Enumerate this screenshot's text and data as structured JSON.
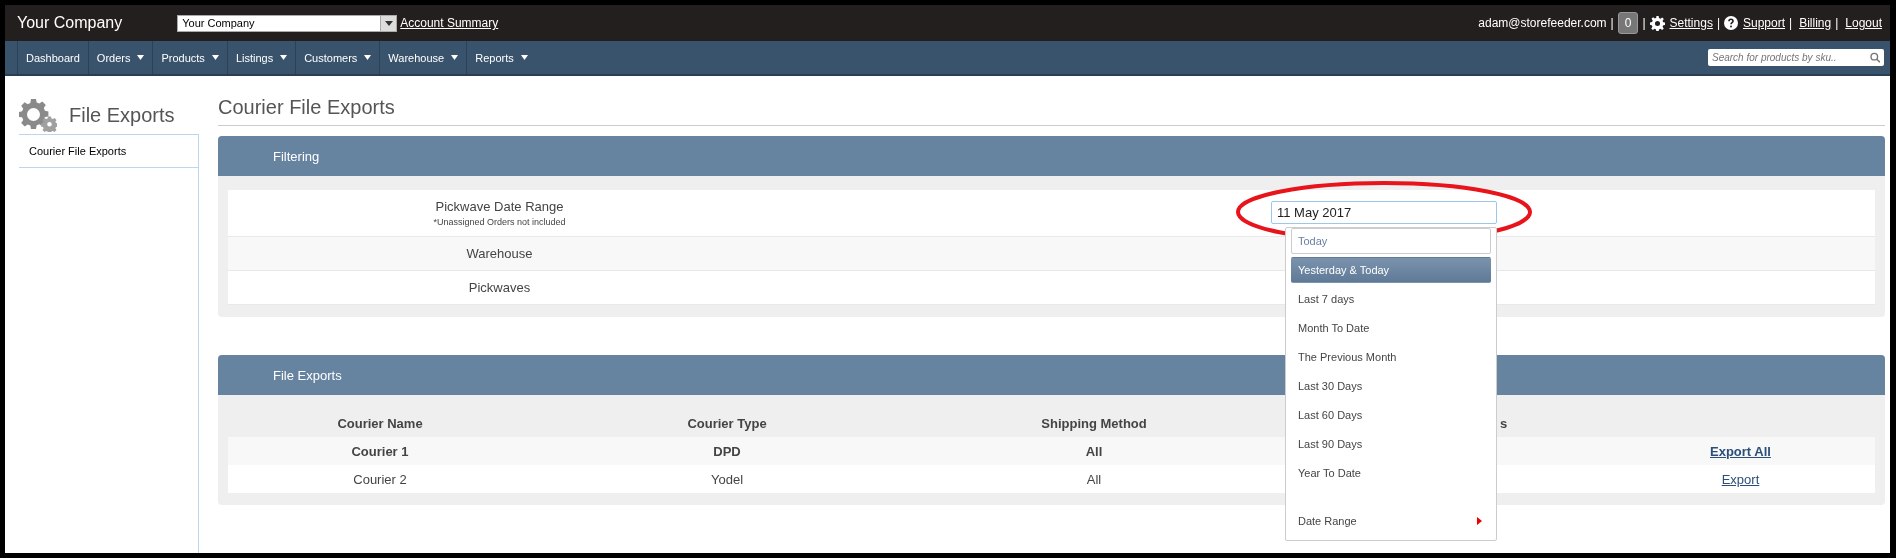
{
  "header": {
    "brand": "Your Company",
    "company_select": {
      "value": "Your Company"
    },
    "account_link": "Account Summary",
    "user_bar": [
      {
        "kind": "email",
        "label": "adam@storefeeder.com"
      },
      {
        "kind": "separator",
        "label": "|"
      },
      {
        "kind": "count",
        "label": "0"
      },
      {
        "kind": "separator",
        "label": "|"
      },
      {
        "kind": "gear_link",
        "label": "Settings"
      },
      {
        "kind": "separator",
        "label": "|"
      },
      {
        "kind": "help_link",
        "label": "Support"
      },
      {
        "kind": "separator",
        "label": "|"
      },
      {
        "kind": "link",
        "label": "Billing"
      },
      {
        "kind": "separator",
        "label": "|"
      },
      {
        "kind": "link",
        "label": "Logout"
      }
    ]
  },
  "nav": {
    "items": [
      {
        "label": "Dashboard",
        "has_menu": false
      },
      {
        "label": "Orders",
        "has_menu": true
      },
      {
        "label": "Products",
        "has_menu": true
      },
      {
        "label": "Listings",
        "has_menu": true
      },
      {
        "label": "Customers",
        "has_menu": true
      },
      {
        "label": "Warehouse",
        "has_menu": true
      },
      {
        "label": "Reports",
        "has_menu": true
      }
    ],
    "search": {
      "placeholder": "Search for products by sku.."
    }
  },
  "sidebar": {
    "title": "File Exports",
    "items": [
      {
        "label": "Courier File Exports",
        "selected": true
      }
    ]
  },
  "page_title": "Courier File Exports",
  "filtering": {
    "title": "Filtering",
    "rows": [
      {
        "label": "Pickwave Date Range",
        "note": "*Unassigned Orders not included",
        "value": "11 May 2017"
      },
      {
        "label": "Warehouse"
      },
      {
        "label": "Pickwaves"
      }
    ],
    "date_menu": [
      {
        "label": "Today",
        "selected": false,
        "focused": true,
        "kind": "option"
      },
      {
        "label": "Yesterday & Today",
        "selected": true,
        "focused": false,
        "kind": "option"
      },
      {
        "label": "Last 7 days",
        "selected": false,
        "focused": false,
        "kind": "option"
      },
      {
        "label": "Month To Date",
        "selected": false,
        "focused": false,
        "kind": "option"
      },
      {
        "label": "The Previous Month",
        "selected": false,
        "focused": false,
        "kind": "option"
      },
      {
        "label": "Last 30 Days",
        "selected": false,
        "focused": false,
        "kind": "option"
      },
      {
        "label": "Last 60 Days",
        "selected": false,
        "focused": false,
        "kind": "option"
      },
      {
        "label": "Last 90 Days",
        "selected": false,
        "focused": false,
        "kind": "option"
      },
      {
        "label": "Year To Date",
        "selected": false,
        "focused": false,
        "kind": "option"
      },
      {
        "label": "Date Range",
        "selected": false,
        "focused": false,
        "kind": "submenu"
      }
    ]
  },
  "file_exports": {
    "title": "File Exports",
    "columns": [
      "Courier Name",
      "Courier Type",
      "Shipping Method",
      "s"
    ],
    "rows": [
      {
        "cells": [
          "Courier 1",
          "DPD",
          "All"
        ],
        "action": "Export All",
        "bold": true
      },
      {
        "cells": [
          "Courier 2",
          "Yodel",
          "All"
        ],
        "action": "Export",
        "bold": false
      }
    ]
  }
}
